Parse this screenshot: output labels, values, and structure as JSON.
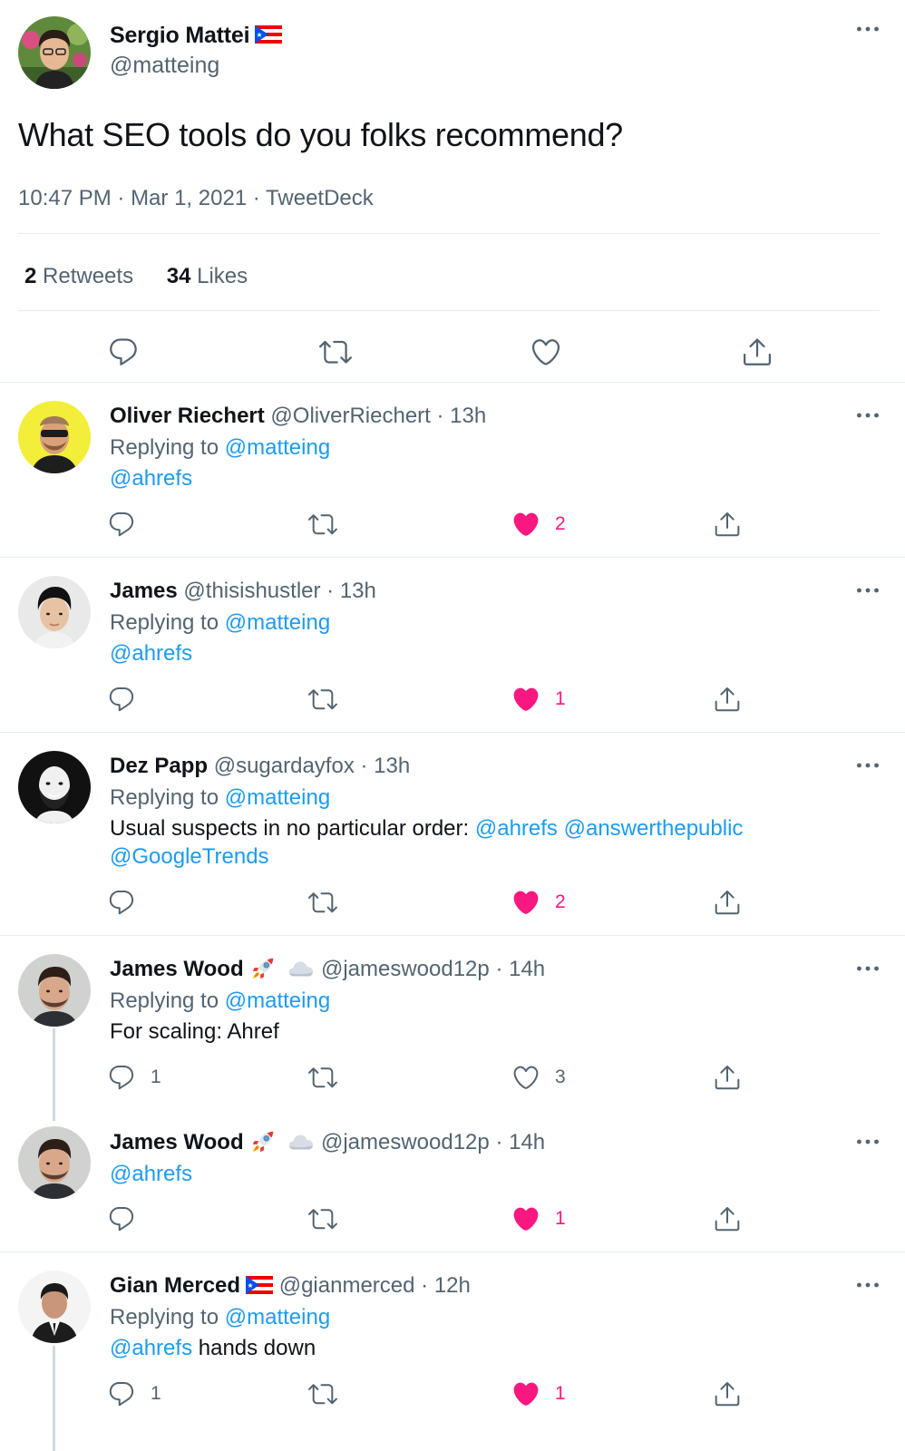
{
  "main_tweet": {
    "author_name": "Sergio Mattei",
    "author_handle": "@matteing",
    "text": "What SEO tools do you folks recommend?",
    "time": "10:47 PM",
    "date": "Mar 1, 2021",
    "source": "TweetDeck",
    "sep": " · ",
    "retweets_count": "2",
    "retweets_label": "Retweets",
    "likes_count": "34",
    "likes_label": "Likes"
  },
  "replying_to_label": "Replying to",
  "replies": [
    {
      "name": "Oliver Riechert",
      "handle": "@OliverRiechert",
      "time": "· 13h",
      "replying_to": "@matteing",
      "text_link": "@ahrefs",
      "likes": "2",
      "liked": true
    },
    {
      "name": "James",
      "handle": "@thisishustler",
      "time": "· 13h",
      "replying_to": "@matteing",
      "text_link": "@ahrefs",
      "likes": "1",
      "liked": true
    },
    {
      "name": "Dez Papp",
      "handle": "@sugardayfox",
      "time": "· 13h",
      "replying_to": "@matteing",
      "text_plain": "Usual suspects in no particular order:",
      "text_link_1": "@ahrefs",
      "text_link_2": "@answerthepublic",
      "text_link_3": "@GoogleTrends",
      "likes": "2",
      "liked": true
    },
    {
      "name": "James Wood",
      "handle": "@jameswood12p",
      "time": "· 14h",
      "replying_to": "@matteing",
      "text_plain": "For scaling: Ahref",
      "replies_count": "1",
      "likes": "3",
      "liked": false
    },
    {
      "name": "James Wood",
      "handle": "@jameswood12p",
      "time": "· 14h",
      "text_link": "@ahrefs",
      "likes": "1",
      "liked": true
    },
    {
      "name": "Gian Merced",
      "handle": "@gianmerced",
      "time": "· 12h",
      "replying_to": "@matteing",
      "text_link": "@ahrefs",
      "text_plain": "hands down",
      "replies_count": "1",
      "likes": "1",
      "liked": true
    }
  ],
  "icons": {
    "reply": "speech-bubble-icon",
    "retweet": "retweet-arrows-icon",
    "like": "heart-icon",
    "share": "share-upload-icon",
    "more": "more-dots-icon",
    "flag": "puerto-rico-flag-icon",
    "rocket": "rocket-emoji-icon",
    "cloud": "cloud-emoji-icon"
  },
  "colors": {
    "link": "#1d9bf0",
    "muted": "#536471",
    "like": "#f91880",
    "divider": "#e6ecf0"
  }
}
